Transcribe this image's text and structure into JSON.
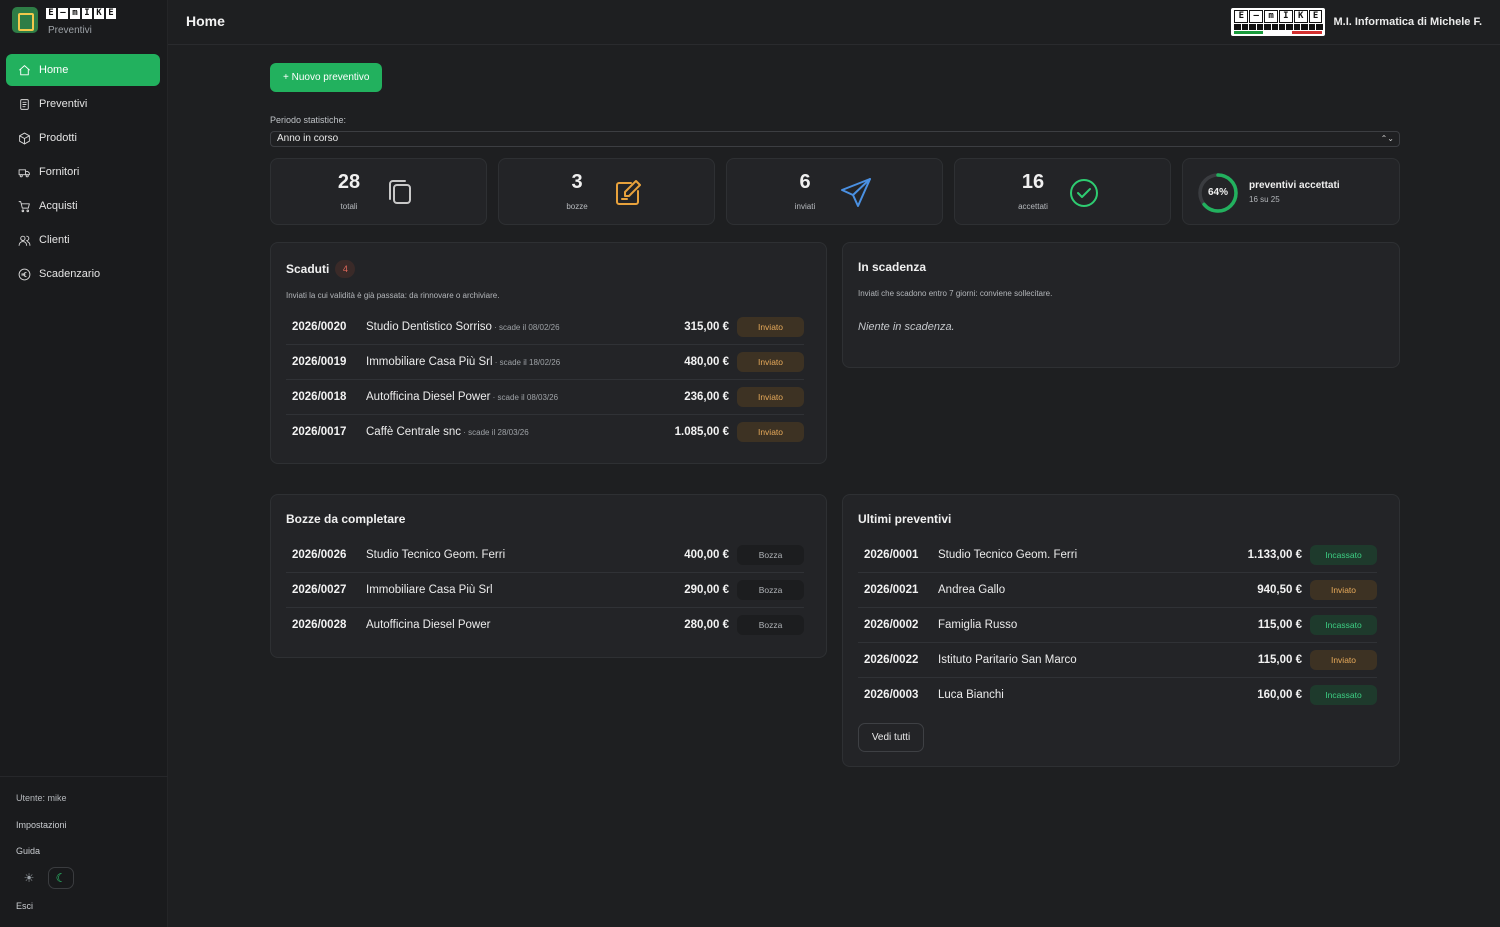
{
  "brand": {
    "wordmark": [
      "E",
      "—",
      "m",
      "I",
      "K",
      "E"
    ],
    "subtitle": "Preventivi"
  },
  "sidebar": {
    "items": [
      {
        "label": "Home",
        "icon": "home-icon",
        "active": true
      },
      {
        "label": "Preventivi",
        "icon": "document-icon"
      },
      {
        "label": "Prodotti",
        "icon": "box-icon"
      },
      {
        "label": "Fornitori",
        "icon": "truck-icon"
      },
      {
        "label": "Acquisti",
        "icon": "cart-icon"
      },
      {
        "label": "Clienti",
        "icon": "users-icon"
      },
      {
        "label": "Scadenzario",
        "icon": "euro-circle-icon"
      }
    ],
    "user": "Utente: mike",
    "settings": "Impostazioni",
    "guide": "Guida",
    "logout": "Esci",
    "theme_light_icon": "☀",
    "theme_dark_icon": "☾"
  },
  "header": {
    "title": "Home",
    "company_logo": [
      "E",
      "—",
      "m",
      "I",
      "K",
      "E"
    ],
    "company_name": "M.I. Informatica di Michele F."
  },
  "actions": {
    "new_quote": "+ Nuovo preventivo"
  },
  "period": {
    "label": "Periodo statistiche:",
    "selected": "Anno in corso",
    "caret": "⌃⌄"
  },
  "stats": {
    "totali": {
      "value": "28",
      "label": "totali",
      "icon": "copy-icon",
      "color": "#c8c8c8"
    },
    "bozze": {
      "value": "3",
      "label": "bozze",
      "icon": "edit-icon",
      "color": "#e8a23c"
    },
    "inviati": {
      "value": "6",
      "label": "inviati",
      "icon": "send-icon",
      "color": "#4a90e2"
    },
    "accettati": {
      "value": "16",
      "label": "accettati",
      "icon": "check-circle-icon",
      "color": "#2ecc71"
    },
    "acceptance": {
      "percent_text": "64%",
      "fraction": 0.64,
      "title": "preventivi accettati",
      "sub": "16 su 25"
    }
  },
  "scaduti": {
    "title": "Scaduti",
    "count": "4",
    "desc": "Inviati la cui validità è già passata: da rinnovare o archiviare.",
    "rows": [
      {
        "code": "2026/0020",
        "client": "Studio Dentistico Sorriso",
        "due": " · scade il 08/02/26",
        "amount": "315,00 €",
        "status": "Inviato"
      },
      {
        "code": "2026/0019",
        "client": "Immobiliare Casa Più Srl",
        "due": " · scade il 18/02/26",
        "amount": "480,00 €",
        "status": "Inviato"
      },
      {
        "code": "2026/0018",
        "client": "Autofficina Diesel Power",
        "due": " · scade il 08/03/26",
        "amount": "236,00 €",
        "status": "Inviato"
      },
      {
        "code": "2026/0017",
        "client": "Caffè Centrale snc",
        "due": " · scade il 28/03/26",
        "amount": "1.085,00 €",
        "status": "Inviato"
      }
    ]
  },
  "in_scadenza": {
    "title": "In scadenza",
    "desc": "Inviati che scadono entro 7 giorni: conviene sollecitare.",
    "empty": "Niente in scadenza."
  },
  "bozze": {
    "title": "Bozze da completare",
    "rows": [
      {
        "code": "2026/0026",
        "client": "Studio Tecnico Geom. Ferri",
        "amount": "400,00 €",
        "status": "Bozza"
      },
      {
        "code": "2026/0027",
        "client": "Immobiliare Casa Più Srl",
        "amount": "290,00 €",
        "status": "Bozza"
      },
      {
        "code": "2026/0028",
        "client": "Autofficina Diesel Power",
        "amount": "280,00 €",
        "status": "Bozza"
      }
    ]
  },
  "ultimi": {
    "title": "Ultimi preventivi",
    "rows": [
      {
        "code": "2026/0001",
        "client": "Studio Tecnico Geom. Ferri",
        "amount": "1.133,00 €",
        "status": "Incassato"
      },
      {
        "code": "2026/0021",
        "client": "Andrea Gallo",
        "amount": "940,50 €",
        "status": "Inviato"
      },
      {
        "code": "2026/0002",
        "client": "Famiglia Russo",
        "amount": "115,00 €",
        "status": "Incassato"
      },
      {
        "code": "2026/0022",
        "client": "Istituto Paritario San Marco",
        "amount": "115,00 €",
        "status": "Inviato"
      },
      {
        "code": "2026/0003",
        "client": "Luca Bianchi",
        "amount": "160,00 €",
        "status": "Incassato"
      }
    ],
    "see_all": "Vedi tutti"
  }
}
